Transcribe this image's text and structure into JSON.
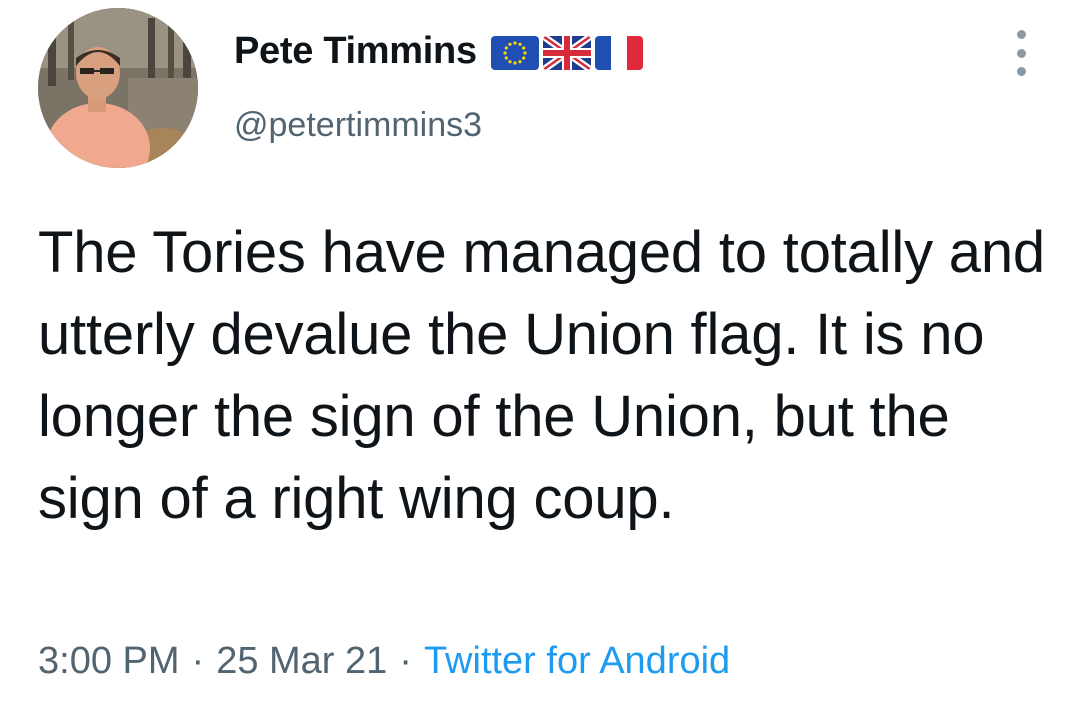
{
  "author": {
    "display_name": "Pete Timmins",
    "username": "@petertimmins3",
    "flags": [
      "eu-flag-icon",
      "uk-flag-icon",
      "france-flag-icon"
    ]
  },
  "tweet": {
    "text": "The Tories have managed to totally and utterly devalue the Union flag. It is no longer the sign of the Union, but the sign of a right wing coup.",
    "time": "3:00 PM",
    "separator": "·",
    "date": "25 Mar 21",
    "source": "Twitter for Android"
  },
  "colors": {
    "text": "#0f1419",
    "secondary": "#536471",
    "link": "#1d9bf0",
    "background": "#ffffff"
  }
}
